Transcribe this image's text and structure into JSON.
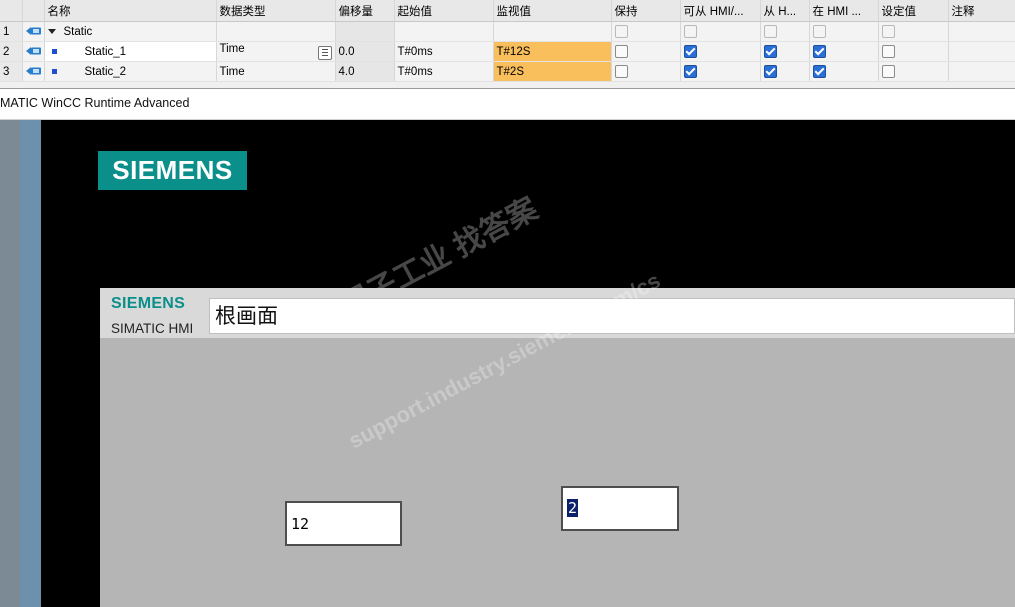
{
  "table": {
    "headers": [
      "名称",
      "数据类型",
      "偏移量",
      "起始值",
      "监视值",
      "保持",
      "可从 HMI/...",
      "从 H...",
      "在 HMI ...",
      "设定值",
      "注释"
    ],
    "rows": [
      {
        "num": "1",
        "name": "Static",
        "type": "",
        "offset": "",
        "start": "",
        "monitor": "",
        "retain": false,
        "hmi_access": false,
        "from_hmi": false,
        "in_hmi": false,
        "setpoint": false
      },
      {
        "num": "2",
        "name": "Static_1",
        "type": "Time",
        "offset": "0.0",
        "start": "T#0ms",
        "monitor": "T#12S",
        "retain": false,
        "hmi_access": true,
        "from_hmi": true,
        "in_hmi": true,
        "setpoint": false
      },
      {
        "num": "3",
        "name": "Static_2",
        "type": "Time",
        "offset": "4.0",
        "start": "T#0ms",
        "monitor": "T#2S",
        "retain": false,
        "hmi_access": true,
        "from_hmi": true,
        "in_hmi": true,
        "setpoint": false
      }
    ]
  },
  "runtime": {
    "window_title": "MATIC WinCC Runtime Advanced",
    "brand_logo": "SIEMENS",
    "panel_brand": "SIEMENS",
    "panel_product": "SIMATIC HMI",
    "screen_title": "根画面",
    "io_field_1": "12",
    "io_field_2": "2"
  },
  "colors": {
    "siemens_teal": "#0a8f8a",
    "monitor_highlight": "#f9bf5c",
    "checkbox_on": "#2a6fd6"
  },
  "watermark": {
    "line1": "西门子工业  找答案",
    "line2": "support.industry.siemens.com/cs"
  }
}
